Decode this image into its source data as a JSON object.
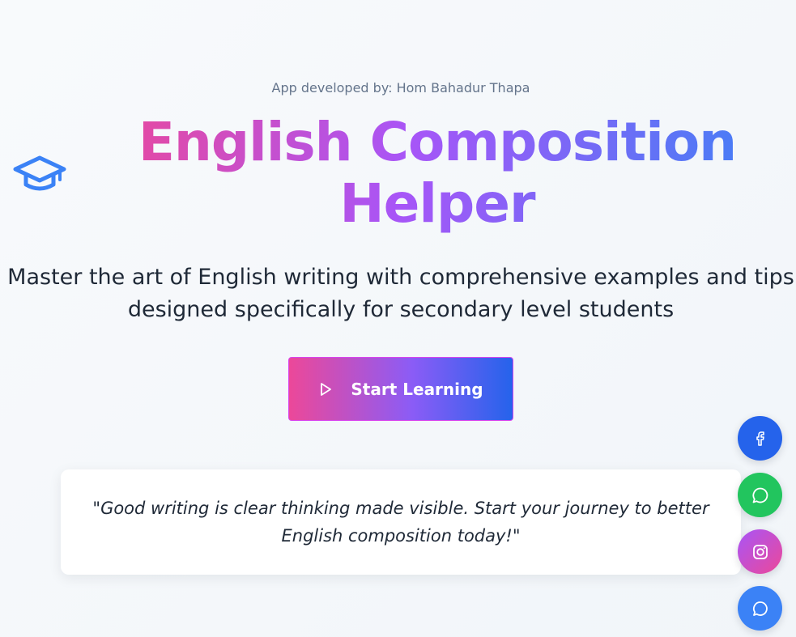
{
  "hero": {
    "credit": "App developed by: Hom Bahadur Thapa",
    "title": "English Composition Helper",
    "subtitle": "Master the art of English writing with comprehensive examples and tips designed specifically for secondary level students",
    "icon": "graduation-cap-icon"
  },
  "cta": {
    "label": "Start Learning",
    "icon": "play-icon"
  },
  "quote": {
    "text": "\"Good writing is clear thinking made visible. Start your journey to better English composition today!\""
  },
  "social": [
    {
      "name": "facebook",
      "icon": "facebook-icon",
      "color": "#2563eb"
    },
    {
      "name": "whatsapp",
      "icon": "whatsapp-icon",
      "color": "#22c55e"
    },
    {
      "name": "instagram",
      "icon": "instagram-icon",
      "color": "#d946ef"
    },
    {
      "name": "messenger",
      "icon": "chat-icon",
      "color": "#3b82f6"
    }
  ],
  "colors": {
    "title_gradient": [
      "#ec4899",
      "#a855f7",
      "#3b82f6"
    ],
    "button_gradient": [
      "#ec4899",
      "#8b5cf6",
      "#2563eb"
    ],
    "cap_icon": "#3b82f6"
  }
}
